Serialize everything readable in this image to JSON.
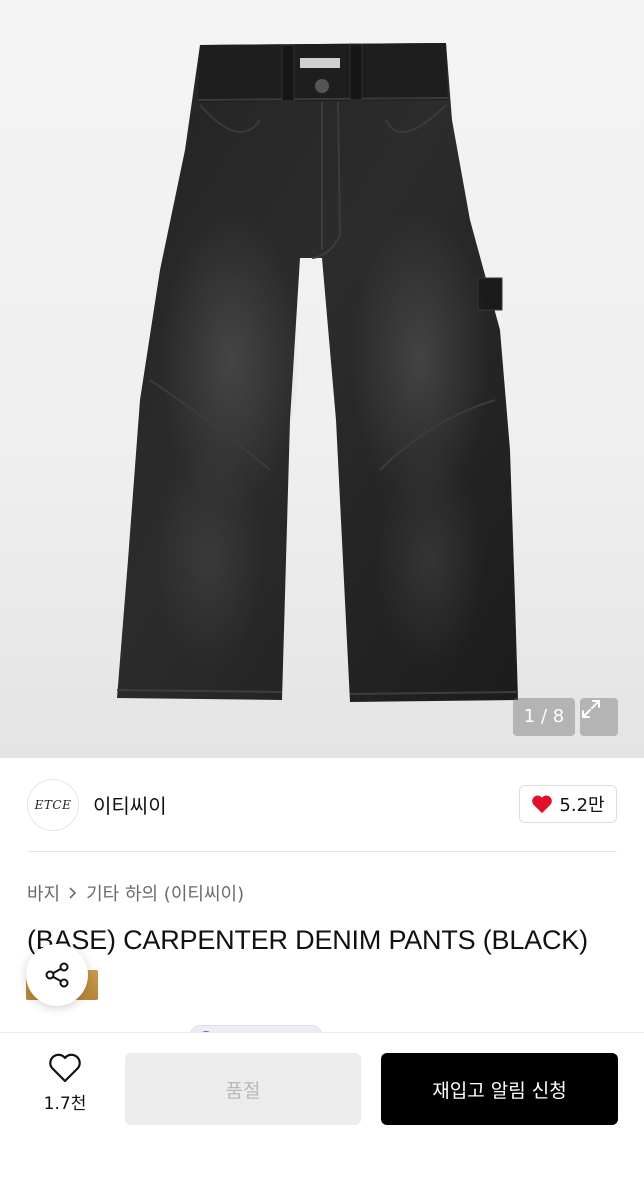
{
  "gallery": {
    "counter": "1 / 8",
    "expand_icon": "expand-diagonal-icon"
  },
  "brand": {
    "logo_text": "ETCE",
    "name": "이티씨이",
    "likes": "5.2만",
    "like_icon": "heart-filled-icon",
    "like_color": "#e0102a"
  },
  "breadcrumb": {
    "category": "바지",
    "separator_icon": "chevron-right-icon",
    "subcategory": "기타 하의 (이티씨이)"
  },
  "product": {
    "title": "(BASE) CARPENTER DENIM PANTS (BLACK)"
  },
  "share": {
    "icon": "share-icon"
  },
  "bottom_bar": {
    "wish_icon": "heart-outline-icon",
    "wish_count": "1.7천",
    "soldout_label": "품절",
    "restock_label": "재입고 알림 신청"
  }
}
